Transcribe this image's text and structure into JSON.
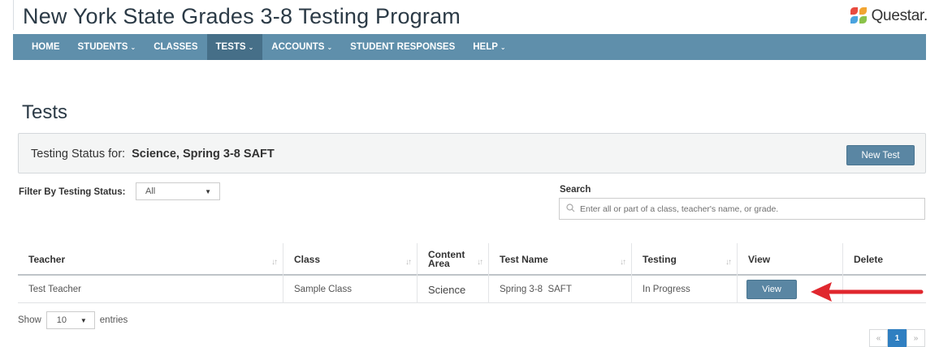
{
  "header": {
    "app_title": "New York State Grades 3-8 Testing Program",
    "brand_name": "Questar."
  },
  "nav": {
    "items": [
      {
        "label": "HOME",
        "has_caret": false,
        "active": false
      },
      {
        "label": "STUDENTS",
        "has_caret": true,
        "active": false
      },
      {
        "label": "CLASSES",
        "has_caret": false,
        "active": false
      },
      {
        "label": "TESTS",
        "has_caret": true,
        "active": true
      },
      {
        "label": "ACCOUNTS",
        "has_caret": true,
        "active": false
      },
      {
        "label": "STUDENT RESPONSES",
        "has_caret": false,
        "active": false
      },
      {
        "label": "HELP",
        "has_caret": true,
        "active": false
      }
    ],
    "caret_glyph": "⌄"
  },
  "page": {
    "title": "Tests"
  },
  "status": {
    "label": "Testing Status for:",
    "value": "Science, Spring 3-8 SAFT",
    "new_test_label": "New Test"
  },
  "filter": {
    "label": "Filter By Testing Status:",
    "selected": "All"
  },
  "search": {
    "label": "Search",
    "placeholder": "Enter all or part of a class, teacher's name, or grade."
  },
  "table": {
    "headers": {
      "teacher": "Teacher",
      "class": "Class",
      "content_area_line1": "Content",
      "content_area_line2": "Area",
      "test_name": "Test Name",
      "testing": "Testing",
      "view": "View",
      "delete": "Delete"
    },
    "rows": [
      {
        "teacher": "Test Teacher",
        "class": "Sample Class",
        "content_area": "Science",
        "test_name": "Spring 3-8  SAFT",
        "testing": "In Progress",
        "view_label": "View",
        "delete": ""
      }
    ]
  },
  "entries": {
    "show_label": "Show",
    "selected": "10",
    "entries_label": "entries"
  },
  "pagination": {
    "prev": "«",
    "current": "1",
    "next": "»"
  },
  "colors": {
    "nav_bg": "#5f8fab",
    "nav_active_bg": "#466f88",
    "button_bg": "#5a86a3",
    "annotation_arrow": "#e0272e",
    "page_active": "#2f7fc1"
  },
  "icons": {
    "search": "magnifier-icon",
    "dropdown": "caret-down-icon",
    "sort": "sort-arrows-icon",
    "annotation": "red-arrow-icon"
  }
}
